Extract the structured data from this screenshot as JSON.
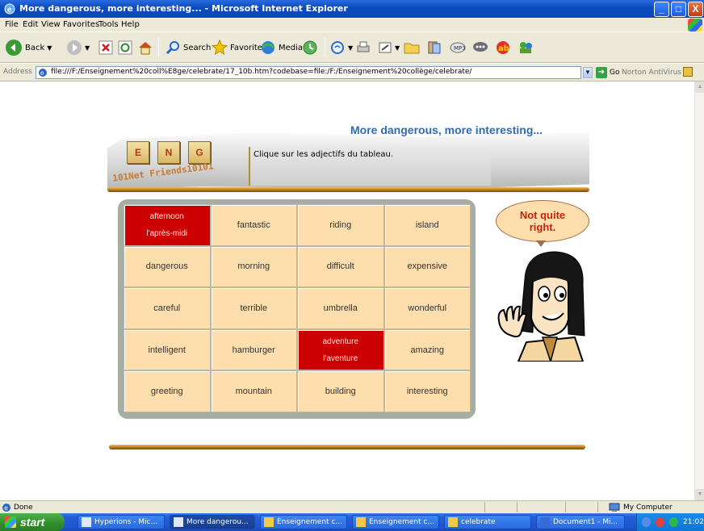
{
  "window": {
    "title": "More dangerous, more interesting... - Microsoft Internet Explorer",
    "minimize": "_",
    "maximize": "□",
    "close": "X"
  },
  "menu": [
    "File",
    "Edit",
    "View",
    "Favorites",
    "Tools",
    "Help"
  ],
  "toolbar": {
    "back_label": "Back",
    "search_label": "Search",
    "favorites_label": "Favorites",
    "media_label": "Media"
  },
  "address": {
    "label": "Address",
    "url": "file:///F:/Enseignement%20coll%E8ge/celebrate/17_10b.htm?codebase=file:/F:/Enseignement%20collège/celebrate/",
    "go_label": "Go",
    "norton_label": "Norton AntiVirus"
  },
  "page": {
    "title": "More dangerous, more interesting...",
    "instruction": "Clique sur les adjectifs du tableau.",
    "logo_letters": [
      "E",
      "N",
      "G"
    ],
    "logo_tagline": "101Net Friends10101",
    "feedback_line1": "Not quite",
    "feedback_line2": "right.",
    "grid": [
      [
        {
          "word": "afternoon",
          "translation": "l'après-midi",
          "state": "wrong"
        },
        {
          "word": "fantastic"
        },
        {
          "word": "riding"
        },
        {
          "word": "island"
        }
      ],
      [
        {
          "word": "dangerous"
        },
        {
          "word": "morning"
        },
        {
          "word": "difficult"
        },
        {
          "word": "expensive"
        }
      ],
      [
        {
          "word": "careful"
        },
        {
          "word": "terrible"
        },
        {
          "word": "umbrella"
        },
        {
          "word": "wonderful"
        }
      ],
      [
        {
          "word": "intelligent"
        },
        {
          "word": "hamburger"
        },
        {
          "word": "adventure",
          "translation": "l'aventure",
          "state": "wrong"
        },
        {
          "word": "amazing"
        }
      ],
      [
        {
          "word": "greeting"
        },
        {
          "word": "mountain"
        },
        {
          "word": "building"
        },
        {
          "word": "interesting"
        }
      ]
    ],
    "colors": {
      "cell": "#ffdeae",
      "wrong_cell": "#cc0000",
      "title": "#2f6ab7",
      "feedback": "#c2250a"
    }
  },
  "status": {
    "left": "Done",
    "zone": "My Computer"
  },
  "taskbar": {
    "start_label": "start",
    "tasks": [
      {
        "label": "Hyperions - Mic...",
        "active": false
      },
      {
        "label": "More dangerou...",
        "active": true
      },
      {
        "label": "Enseignement c...",
        "active": false
      },
      {
        "label": "Enseignement c...",
        "active": false
      },
      {
        "label": "celebrate",
        "active": false
      },
      {
        "label": "Document1 - Mi...",
        "active": false
      }
    ],
    "clock": "21:02"
  }
}
